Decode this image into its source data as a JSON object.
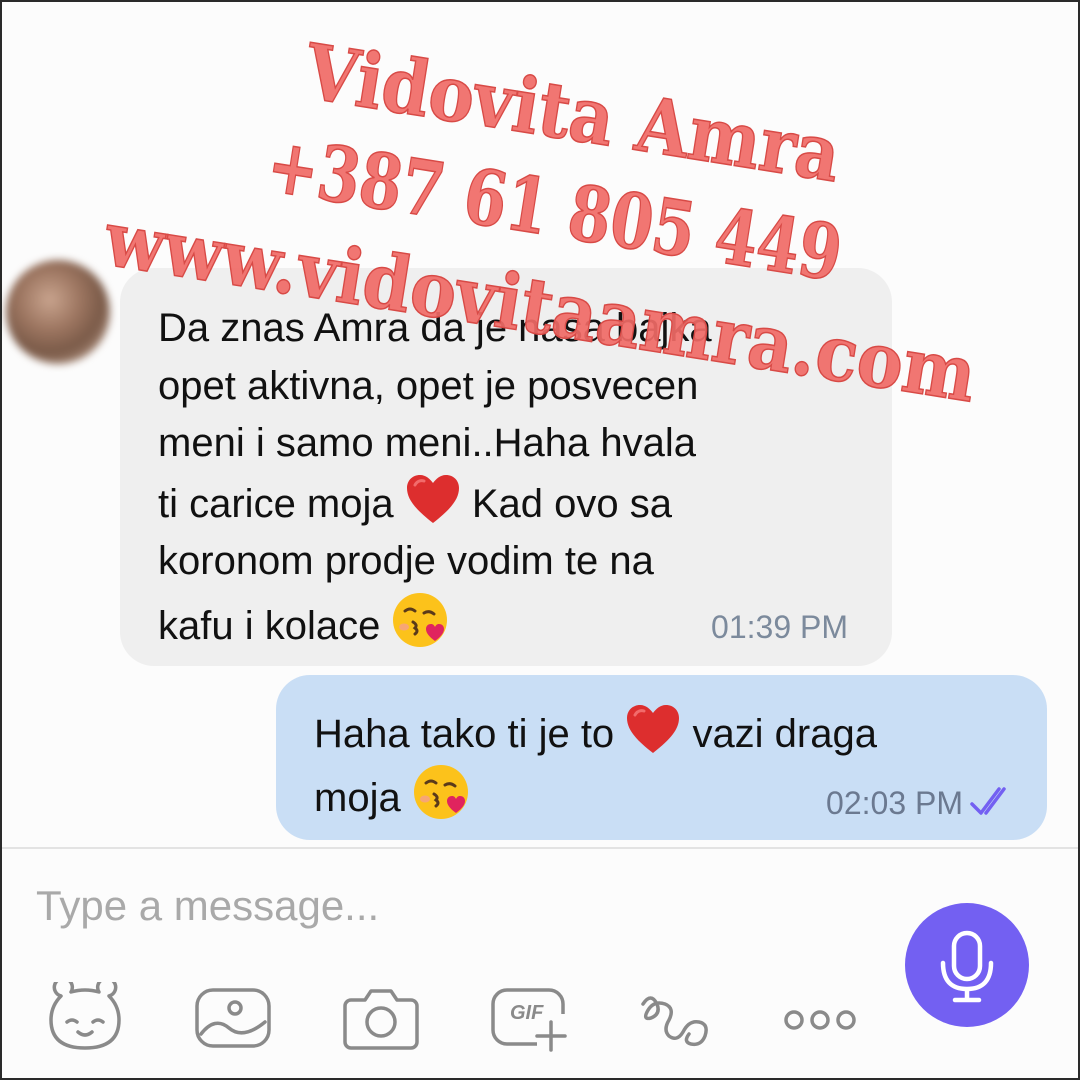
{
  "messages": [
    {
      "direction": "incoming",
      "text_lines": [
        "Da znas Amra da je nasa bajka",
        "opet aktivna, opet je posvecen",
        "meni i samo meni..Haha hvala",
        "ti carice moja",
        "Kad ovo sa",
        "koronom prodje vodim te na",
        "kafu i kolace"
      ],
      "time": "01:39 PM"
    },
    {
      "direction": "outgoing",
      "text_parts": [
        "Haha tako ti je to",
        "vazi draga",
        "moja"
      ],
      "time": "02:03 PM",
      "status": "double-check-read"
    }
  ],
  "composer": {
    "placeholder": "Type a message...",
    "value": ""
  },
  "toolbar": {
    "gif_label": "GIF"
  },
  "watermark": {
    "line1": "Vidovita Amra",
    "line2": "+387 61 805 449",
    "line3": "www.vidovitaamra.com"
  },
  "colors": {
    "incoming_bubble": "#efefef",
    "outgoing_bubble": "#c9def5",
    "accent": "#7360f2",
    "read_ticks": "#7360f2",
    "watermark": "#f06a66"
  },
  "icons": {
    "heart": "red-heart-emoji",
    "kiss": "face-blowing-kiss-emoji",
    "mic": "microphone-icon",
    "sticker": "sticker-bear-icon",
    "gallery": "gallery-image-icon",
    "camera": "camera-icon",
    "gif": "gif-icon",
    "doodle": "doodle-icon",
    "more": "more-dots-icon"
  }
}
